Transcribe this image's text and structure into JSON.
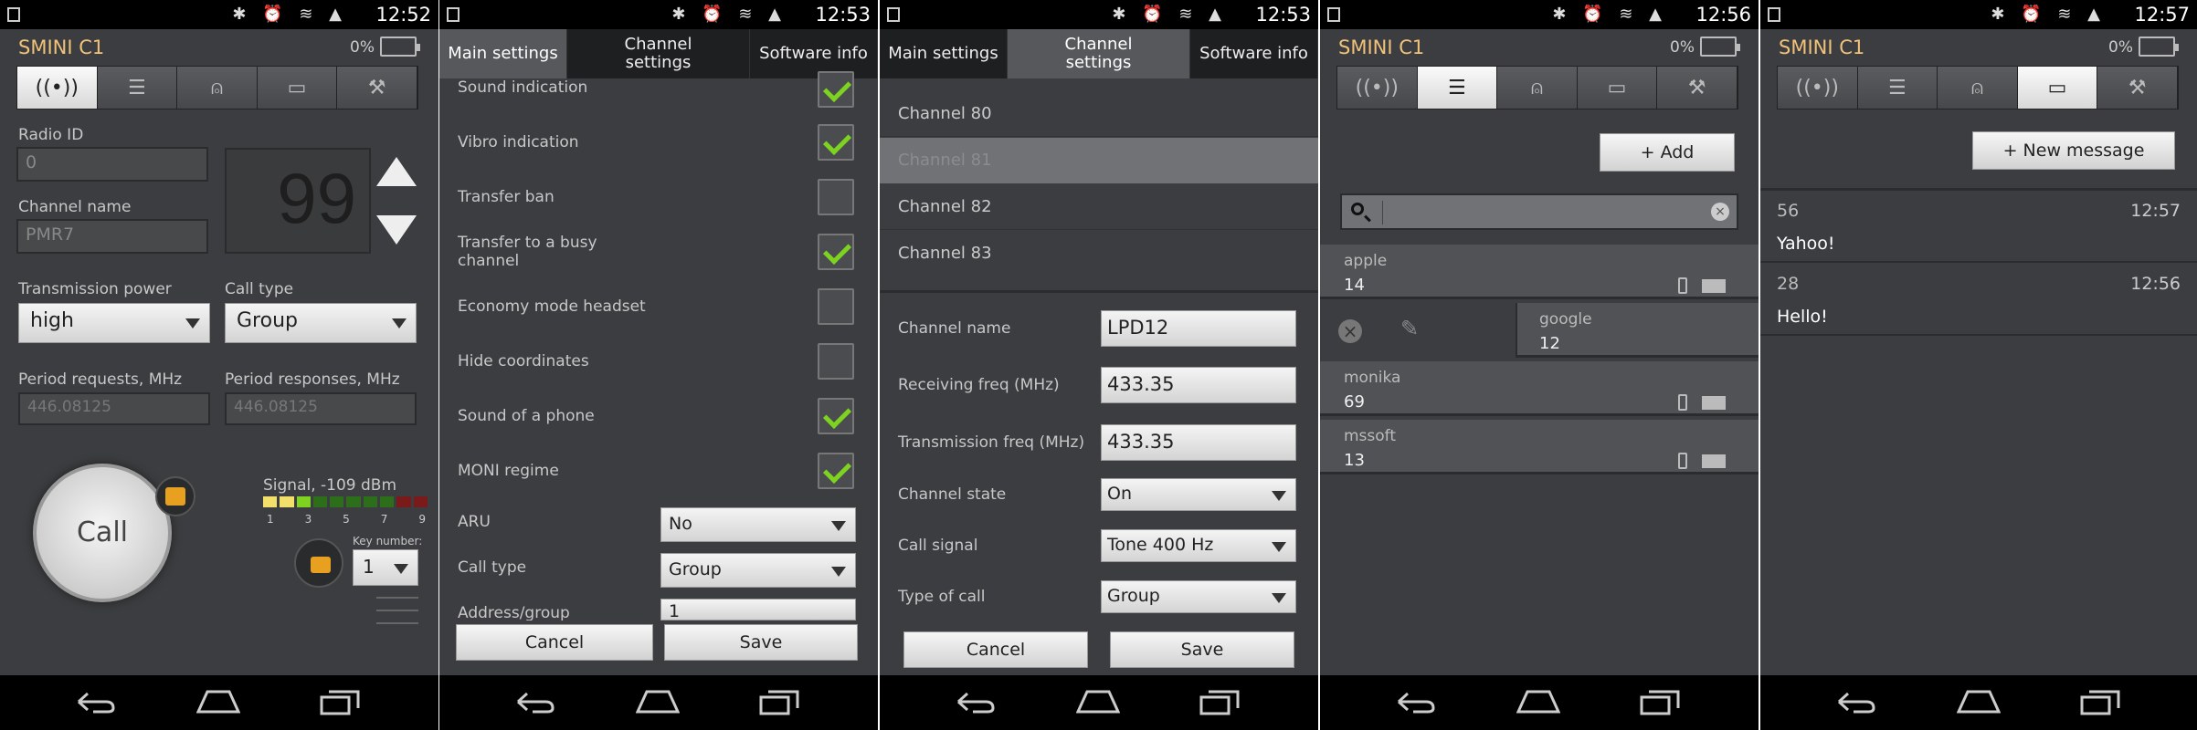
{
  "screens": [
    {
      "time": "12:52",
      "app_title": "SMINI C1",
      "battery": "0%",
      "radio_id_label": "Radio ID",
      "radio_id_value": "0",
      "channel_name_label": "Channel name",
      "channel_name_value": "PMR7",
      "channel_number": "99",
      "tx_power_label": "Transmission power",
      "tx_power_value": "high",
      "call_type_label": "Call type",
      "call_type_value": "Group",
      "period_req_label": "Period requests, MHz",
      "period_req_value": "446.08125",
      "period_resp_label": "Period responses, MHz",
      "period_resp_value": "446.08125",
      "signal_label": "Signal, -109 dBm",
      "signal_ticks": [
        "1",
        "3",
        "5",
        "7",
        "9"
      ],
      "call_label": "Call",
      "key_number_label": "Key number:",
      "key_number_value": "1"
    },
    {
      "time": "12:53",
      "tabs": [
        "Main settings",
        "Channel settings",
        "Software info"
      ],
      "settings": [
        {
          "label": "Sound indication",
          "checked": true
        },
        {
          "label": "Vibro indication",
          "checked": true
        },
        {
          "label": "Transfer ban",
          "checked": false
        },
        {
          "label": "Transfer to a busy channel",
          "checked": true
        },
        {
          "label": "Economy mode headset",
          "checked": false
        },
        {
          "label": "Hide coordinates",
          "checked": false
        },
        {
          "label": "Sound of a phone",
          "checked": true
        },
        {
          "label": "MONI regime",
          "checked": true
        }
      ],
      "aru_label": "ARU",
      "aru_value": "No",
      "call_type_label": "Call type",
      "call_type_value": "Group",
      "address_label": "Address/group",
      "address_value": "1",
      "cancel": "Cancel",
      "save": "Save"
    },
    {
      "time": "12:53",
      "tabs": [
        "Main settings",
        "Channel settings",
        "Software info"
      ],
      "channels": [
        "Channel 80",
        "Channel 81",
        "Channel 82",
        "Channel 83"
      ],
      "selected_channel": "Channel 81",
      "channel_name_label": "Channel name",
      "channel_name_value": "LPD12",
      "rx_label": "Receiving freq (MHz)",
      "rx_value": "433.35",
      "tx_label": "Transmission freq (MHz)",
      "tx_value": "433.35",
      "state_label": "Channel state",
      "state_value": "On",
      "signal_label": "Call signal",
      "signal_value": "Tone 400 Hz",
      "type_label": "Type of call",
      "type_value": "Group",
      "cancel": "Cancel",
      "save": "Save"
    },
    {
      "time": "12:56",
      "app_title": "SMINI C1",
      "battery": "0%",
      "add_label": "+ Add",
      "search_placeholder": "",
      "contacts": [
        {
          "name": "apple",
          "number": "14"
        },
        {
          "name": "google",
          "number": "12"
        },
        {
          "name": "monika",
          "number": "69"
        },
        {
          "name": "mssoft",
          "number": "13"
        }
      ]
    },
    {
      "time": "12:57",
      "app_title": "SMINI C1",
      "battery": "0%",
      "new_message_label": "+ New message",
      "messages": [
        {
          "from": "56",
          "time": "12:57",
          "text": "Yahoo!"
        },
        {
          "from": "28",
          "time": "12:56",
          "text": "Hello!"
        }
      ]
    }
  ]
}
